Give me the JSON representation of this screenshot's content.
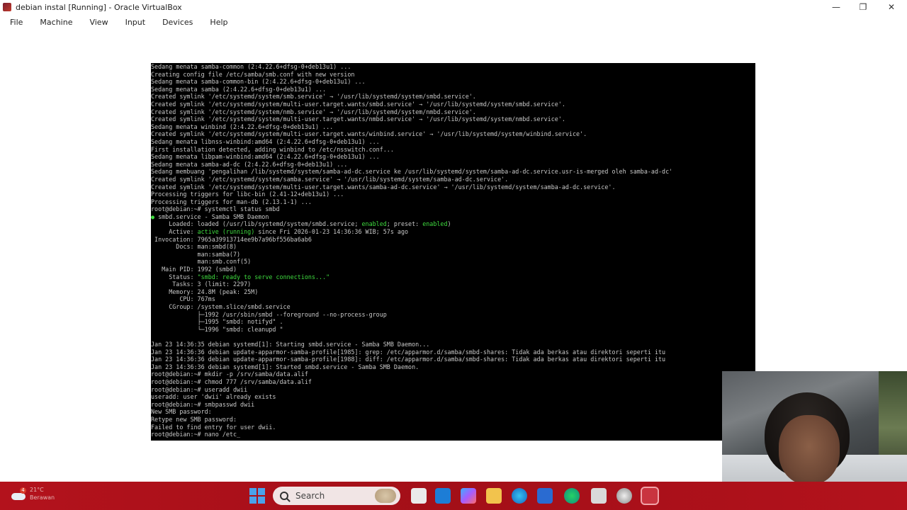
{
  "window": {
    "title": "debian instal [Running] - Oracle VirtualBox",
    "controls": [
      "—",
      "❐",
      "✕"
    ]
  },
  "menu": [
    "File",
    "Machine",
    "View",
    "Input",
    "Devices",
    "Help"
  ],
  "terminal": {
    "lines": [
      "Sedang menata samba-common (2:4.22.6+dfsg-0+deb13u1) ...",
      "Creating config file /etc/samba/smb.conf with new version",
      "Sedang menata samba-common-bin (2:4.22.6+dfsg-0+deb13u1) ...",
      "Sedang menata samba (2:4.22.6+dfsg-0+deb13u1) ...",
      "Created symlink '/etc/systemd/system/smb.service' → '/usr/lib/systemd/system/smbd.service'.",
      "Created symlink '/etc/systemd/system/multi-user.target.wants/smbd.service' → '/usr/lib/systemd/system/smbd.service'.",
      "Created symlink '/etc/systemd/system/nmb.service' → '/usr/lib/systemd/system/nmbd.service'.",
      "Created symlink '/etc/systemd/system/multi-user.target.wants/nmbd.service' → '/usr/lib/systemd/system/nmbd.service'.",
      "Sedang menata winbind (2:4.22.6+dfsg-0+deb13u1) ...",
      "Created symlink '/etc/systemd/system/multi-user.target.wants/winbind.service' → '/usr/lib/systemd/system/winbind.service'.",
      "Sedang menata libnss-winbind:amd64 (2:4.22.6+dfsg-0+deb13u1) ...",
      "First installation detected, adding winbind to /etc/nsswitch.conf...",
      "Sedang menata libpam-winbind:amd64 (2:4.22.6+dfsg-0+deb13u1) ...",
      "Sedang menata samba-ad-dc (2:4.22.6+dfsg-0+deb13u1) ...",
      "Sedang membuang 'pengalihan /lib/systemd/system/samba-ad-dc.service ke /usr/lib/systemd/system/samba-ad-dc.service.usr-is-merged oleh samba-ad-dc'",
      "Created symlink '/etc/systemd/system/samba.service' → '/usr/lib/systemd/system/samba-ad-dc.service'.",
      "Created symlink '/etc/systemd/system/multi-user.target.wants/samba-ad-dc.service' → '/usr/lib/systemd/system/samba-ad-dc.service'.",
      "Processing triggers for libc-bin (2.41-12+deb13u1) ...",
      "Processing triggers for man-db (2.13.1-1) ...",
      "root@debian:~# systemctl status smbd"
    ],
    "status_head": "● smbd.service - Samba SMB Daemon",
    "loaded_prefix": "     Loaded: loaded (/usr/lib/systemd/system/smbd.service; ",
    "loaded_enabled": "enabled",
    "loaded_mid": "; preset: ",
    "loaded_preset": "enabled",
    "loaded_suffix": ")",
    "active_prefix": "     Active: ",
    "active_state": "active (running)",
    "active_suffix": " since Fri 2026-01-23 14:36:36 WIB; 57s ago",
    "status_lines": [
      " Invocation: 7965a39913714ee9b7a96bf556ba6ab6",
      "       Docs: man:smbd(8)",
      "             man:samba(7)",
      "             man:smb.conf(5)",
      "   Main PID: 1992 (smbd)"
    ],
    "status_label_prefix": "     Status: ",
    "status_label_value": "\"smbd: ready to serve connections...\"",
    "status_lines2": [
      "      Tasks: 3 (limit: 2297)",
      "     Memory: 24.8M (peak: 25M)",
      "        CPU: 767ms",
      "     CGroup: /system.slice/smbd.service",
      "             ├─1992 /usr/sbin/smbd --foreground --no-process-group",
      "             ├─1995 \"smbd: notifyd\" .",
      "             └─1996 \"smbd: cleanupd \""
    ],
    "log_lines": [
      "Jan 23 14:36:35 debian systemd[1]: Starting smbd.service - Samba SMB Daemon...",
      "Jan 23 14:36:36 debian update-apparmor-samba-profile[1985]: grep: /etc/apparmor.d/samba/smbd-shares: Tidak ada berkas atau direktori seperti itu",
      "Jan 23 14:36:36 debian update-apparmor-samba-profile[1988]: diff: /etc/apparmor.d/samba/smbd-shares: Tidak ada berkas atau direktori seperti itu",
      "Jan 23 14:36:36 debian systemd[1]: Started smbd.service - Samba SMB Daemon.",
      "root@debian:~# mkdir -p /srv/samba/data.alif",
      "root@debian:~# chmod 777 /srv/samba/data.alif",
      "root@debian:~# useradd dwii",
      "useradd: user 'dwii' already exists",
      "root@debian:~# smbpasswd dwii",
      "New SMB password:",
      "Retype new SMB password:",
      "Failed to find entry for user dwii.",
      "root@debian:~# nano /etc_"
    ]
  },
  "taskbar": {
    "weather_badge": "4",
    "weather_text_1": "21°C",
    "weather_text_2": "Berawan",
    "search_label": "Search"
  }
}
